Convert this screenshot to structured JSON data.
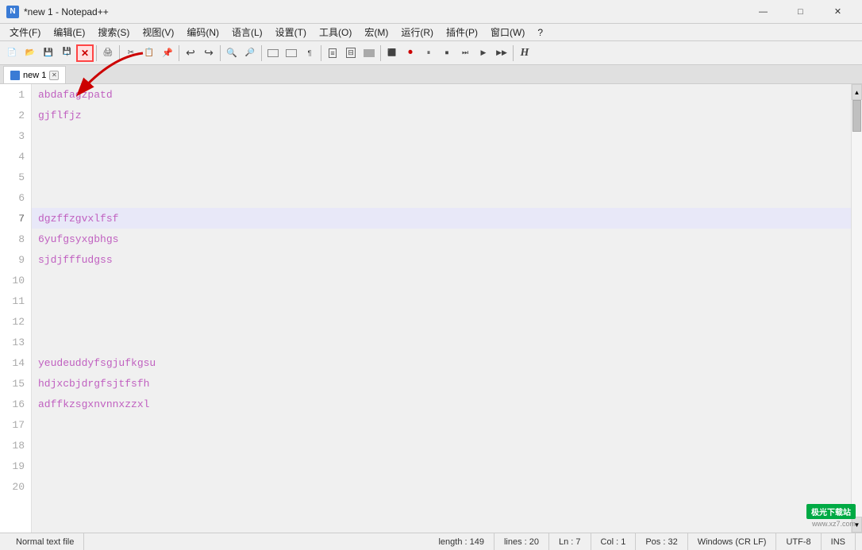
{
  "window": {
    "title": "*new 1 - Notepad++",
    "icon": "N++"
  },
  "titlebar": {
    "title": "*new 1 - Notepad++",
    "minimize": "—",
    "maximize": "□",
    "close": "✕"
  },
  "menubar": {
    "items": [
      {
        "label": "文件(F)"
      },
      {
        "label": "编辑(E)"
      },
      {
        "label": "搜索(S)"
      },
      {
        "label": "视图(V)"
      },
      {
        "label": "编码(N)"
      },
      {
        "label": "语言(L)"
      },
      {
        "label": "设置(T)"
      },
      {
        "label": "工具(O)"
      },
      {
        "label": "宏(M)"
      },
      {
        "label": "运行(R)"
      },
      {
        "label": "插件(P)"
      },
      {
        "label": "窗口(W)"
      },
      {
        "label": "?"
      }
    ]
  },
  "tab": {
    "label": "new 1",
    "modified": true
  },
  "editor": {
    "lines": [
      {
        "num": 1,
        "text": "abdafagzpatd",
        "selected": false
      },
      {
        "num": 2,
        "text": "gjflfjz",
        "selected": false
      },
      {
        "num": 3,
        "text": "",
        "selected": false
      },
      {
        "num": 4,
        "text": "",
        "selected": false
      },
      {
        "num": 5,
        "text": "",
        "selected": false
      },
      {
        "num": 6,
        "text": "",
        "selected": false
      },
      {
        "num": 7,
        "text": "dgzffzgvxlfsf",
        "selected": true
      },
      {
        "num": 8,
        "text": "6yufgsyxgbhgs",
        "selected": false
      },
      {
        "num": 9,
        "text": "sjdjfffudgss",
        "selected": false
      },
      {
        "num": 10,
        "text": "",
        "selected": false
      },
      {
        "num": 11,
        "text": "",
        "selected": false
      },
      {
        "num": 12,
        "text": "",
        "selected": false
      },
      {
        "num": 13,
        "text": "",
        "selected": false
      },
      {
        "num": 14,
        "text": "yeudeuddyfsgjufkgsu",
        "selected": false
      },
      {
        "num": 15,
        "text": "hdjxcbjdrgfsjtfsfh",
        "selected": false
      },
      {
        "num": 16,
        "text": "adffkzsgxnvnnxzzxl",
        "selected": false
      },
      {
        "num": 17,
        "text": "",
        "selected": false
      },
      {
        "num": 18,
        "text": "",
        "selected": false
      },
      {
        "num": 19,
        "text": "",
        "selected": false
      },
      {
        "num": 20,
        "text": "",
        "selected": false
      }
    ]
  },
  "statusbar": {
    "file_type": "Normal text file",
    "length": "length : 149",
    "lines": "lines : 20",
    "ln": "Ln : 7",
    "col": "Col : 1",
    "pos": "Pos : 32",
    "line_ending": "Windows (CR LF)",
    "encoding": "UTF-8",
    "ins": "INS"
  },
  "watermark": {
    "logo": "极光下载站",
    "url": "www.xz7.com"
  }
}
